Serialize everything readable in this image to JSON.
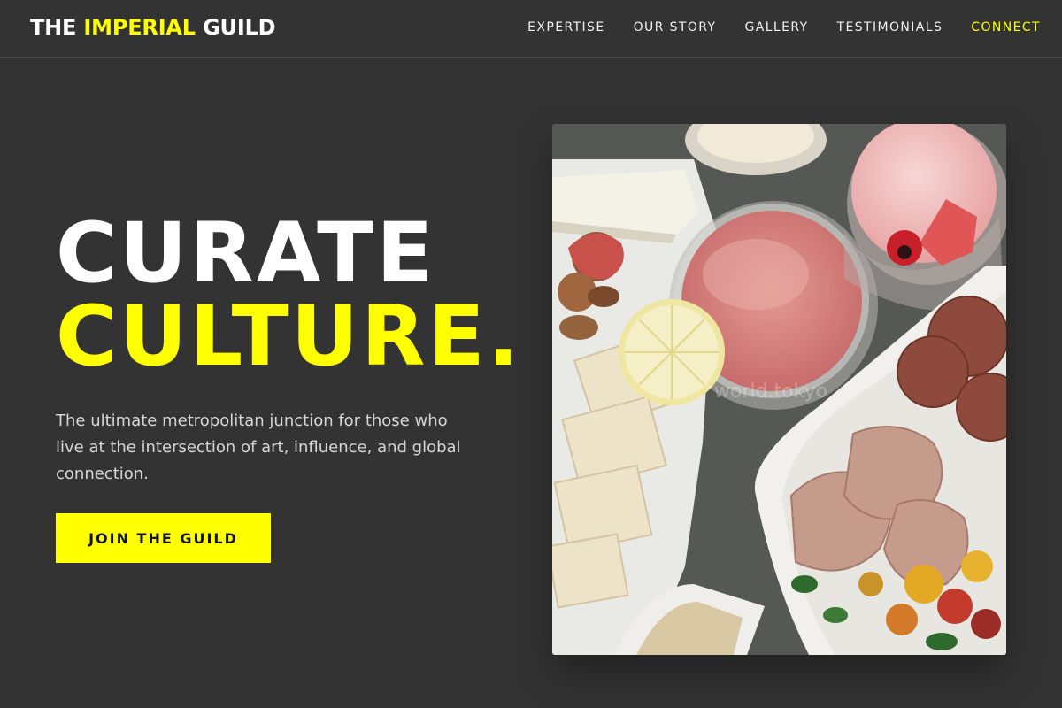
{
  "brand": {
    "prefix": "THE",
    "highlight": "IMPERIAL",
    "suffix": "GUILD"
  },
  "nav": {
    "items": [
      {
        "label": "EXPERTISE",
        "active": false
      },
      {
        "label": "OUR STORY",
        "active": false
      },
      {
        "label": "GALLERY",
        "active": false
      },
      {
        "label": "TESTIMONIALS",
        "active": false
      },
      {
        "label": "CONNECT",
        "active": true
      }
    ]
  },
  "hero": {
    "title_line1": "CURATE",
    "title_line2": "CULTURE.",
    "subtitle": "The ultimate metropolitan junction for those who live at the intersection of art, influence, and global connection.",
    "cta_label": "JOIN THE GUILD"
  },
  "photo": {
    "watermark": "world.tokyo"
  },
  "colors": {
    "background": "#333333",
    "accent": "#ffff00",
    "text": "#ffffff",
    "muted_text": "#d6d6d6"
  }
}
